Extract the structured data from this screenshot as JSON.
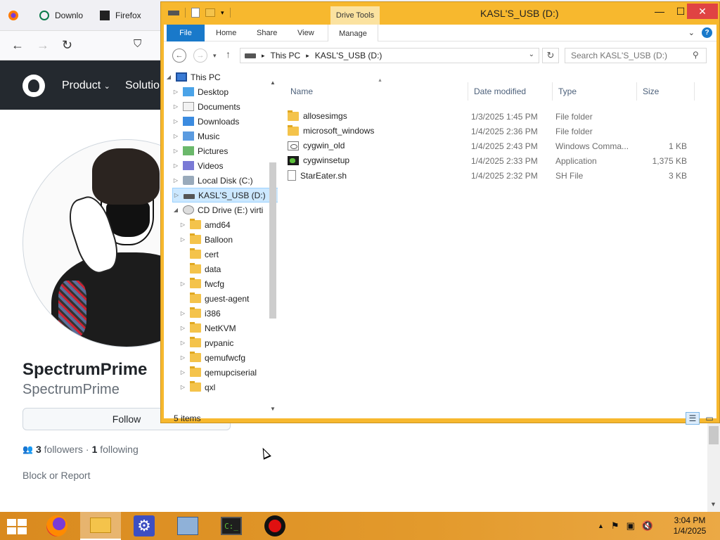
{
  "browser": {
    "tabs": [
      {
        "label": ""
      },
      {
        "label": "Downlo"
      },
      {
        "label": "Firefox"
      }
    ],
    "github_menu": [
      "Product",
      "Solutio"
    ],
    "profile": {
      "name": "SpectrumPrime",
      "login": "SpectrumPrime",
      "follow_label": "Follow",
      "followers_count": "3",
      "followers_label": "followers",
      "separator": "·",
      "following_count": "1",
      "following_label": "following",
      "block_label": "Block or Report"
    }
  },
  "explorer": {
    "title": "KASL'S_USB (D:)",
    "context_tab": "Drive Tools",
    "ribbon_tabs": [
      "File",
      "Home",
      "Share",
      "View",
      "Manage"
    ],
    "address": {
      "segments": [
        "This PC",
        "KASL'S_USB (D:)"
      ]
    },
    "search_placeholder": "Search KASL'S_USB (D:)",
    "nav_tree": [
      {
        "label": "This PC",
        "icon": "pc-icon",
        "expander": "expanded",
        "level": 0,
        "selected": false
      },
      {
        "label": "Desktop",
        "icon": "desktop-icon",
        "expander": "collapsed",
        "level": 1,
        "selected": false
      },
      {
        "label": "Documents",
        "icon": "documents-icon",
        "expander": "collapsed",
        "level": 1,
        "selected": false
      },
      {
        "label": "Downloads",
        "icon": "downloads-icon",
        "expander": "collapsed",
        "level": 1,
        "selected": false
      },
      {
        "label": "Music",
        "icon": "music-icon",
        "expander": "collapsed",
        "level": 1,
        "selected": false
      },
      {
        "label": "Pictures",
        "icon": "pictures-icon",
        "expander": "collapsed",
        "level": 1,
        "selected": false
      },
      {
        "label": "Videos",
        "icon": "videos-icon",
        "expander": "collapsed",
        "level": 1,
        "selected": false
      },
      {
        "label": "Local Disk (C:)",
        "icon": "disk-icon",
        "expander": "collapsed",
        "level": 1,
        "selected": false
      },
      {
        "label": "KASL'S_USB (D:)",
        "icon": "usb-drive-icon",
        "expander": "collapsed",
        "level": 1,
        "selected": true
      },
      {
        "label": "CD Drive (E:) virti",
        "icon": "cd-drive-icon",
        "expander": "expanded",
        "level": 1,
        "selected": false
      },
      {
        "label": "amd64",
        "icon": "folder-icon",
        "expander": "collapsed",
        "level": 2,
        "selected": false
      },
      {
        "label": "Balloon",
        "icon": "folder-icon",
        "expander": "collapsed",
        "level": 2,
        "selected": false
      },
      {
        "label": "cert",
        "icon": "folder-icon",
        "expander": "none",
        "level": 2,
        "selected": false
      },
      {
        "label": "data",
        "icon": "folder-icon",
        "expander": "none",
        "level": 2,
        "selected": false
      },
      {
        "label": "fwcfg",
        "icon": "folder-icon",
        "expander": "collapsed",
        "level": 2,
        "selected": false
      },
      {
        "label": "guest-agent",
        "icon": "folder-icon",
        "expander": "none",
        "level": 2,
        "selected": false
      },
      {
        "label": "i386",
        "icon": "folder-icon",
        "expander": "collapsed",
        "level": 2,
        "selected": false
      },
      {
        "label": "NetKVM",
        "icon": "folder-icon",
        "expander": "collapsed",
        "level": 2,
        "selected": false
      },
      {
        "label": "pvpanic",
        "icon": "folder-icon",
        "expander": "collapsed",
        "level": 2,
        "selected": false
      },
      {
        "label": "qemufwcfg",
        "icon": "folder-icon",
        "expander": "collapsed",
        "level": 2,
        "selected": false
      },
      {
        "label": "qemupciserial",
        "icon": "folder-icon",
        "expander": "collapsed",
        "level": 2,
        "selected": false
      },
      {
        "label": "qxl",
        "icon": "folder-icon",
        "expander": "collapsed",
        "level": 2,
        "selected": false
      }
    ],
    "columns": [
      "Name",
      "Date modified",
      "Type",
      "Size"
    ],
    "files": [
      {
        "name": "allosesimgs",
        "date": "1/3/2025 1:45 PM",
        "type": "File folder",
        "size": "",
        "icon": "folder-icon"
      },
      {
        "name": "microsoft_windows",
        "date": "1/4/2025 2:36 PM",
        "type": "File folder",
        "size": "",
        "icon": "folder-icon"
      },
      {
        "name": "cygwin_old",
        "date": "1/4/2025 2:43 PM",
        "type": "Windows Comma...",
        "size": "1 KB",
        "icon": "cmd-file-icon"
      },
      {
        "name": "cygwinsetup",
        "date": "1/4/2025 2:33 PM",
        "type": "Application",
        "size": "1,375 KB",
        "icon": "application-icon"
      },
      {
        "name": "StarEater.sh",
        "date": "1/4/2025 2:32 PM",
        "type": "SH File",
        "size": "3 KB",
        "icon": "sh-file-icon"
      }
    ],
    "status": "5 items"
  },
  "taskbar": {
    "clock_time": "3:04 PM",
    "clock_date": "1/4/2025"
  },
  "colors": {
    "window_frame": "#f7b82e",
    "ribbon_file": "#1979ca",
    "selection": "#cce8ff",
    "github_header": "#24292f",
    "taskbar": "#e39a2c"
  }
}
